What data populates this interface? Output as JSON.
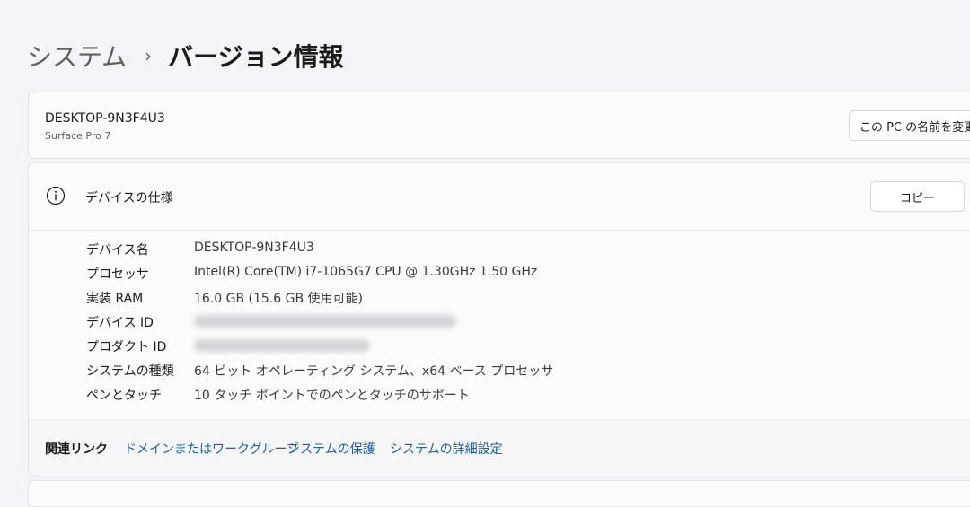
{
  "breadcrumb": {
    "parent": "システム",
    "separator": "›",
    "current": "バージョン情報"
  },
  "device_card": {
    "name": "DESKTOP-9N3F4U3",
    "model": "Surface Pro 7",
    "rename_button": "この PC の名前を変更"
  },
  "specs": {
    "title": "デバイスの仕様",
    "icon": "info-icon",
    "copy_button": "コピー",
    "rows": [
      {
        "label": "デバイス名",
        "value": "DESKTOP-9N3F4U3"
      },
      {
        "label": "プロセッサ",
        "value": "Intel(R) Core(TM) i7-1065G7 CPU @ 1.30GHz   1.50 GHz"
      },
      {
        "label": "実装 RAM",
        "value": "16.0 GB (15.6 GB 使用可能)"
      },
      {
        "label": "デバイス ID",
        "value": ""
      },
      {
        "label": "プロダクト ID",
        "value": ""
      },
      {
        "label": "システムの種類",
        "value": "64 ビット オペレーティング システム、x64 ベース プロセッサ"
      },
      {
        "label": "ペンとタッチ",
        "value": "10 タッチ ポイントでのペンとタッチのサポート"
      }
    ]
  },
  "related": {
    "title": "関連リンク",
    "links": [
      "ドメインまたはワークグループ",
      "システムの保護",
      "システムの詳細設定"
    ]
  },
  "colors": {
    "background": "#f3f4f7",
    "card": "#fbfbfc",
    "link": "#1a5fa8"
  }
}
